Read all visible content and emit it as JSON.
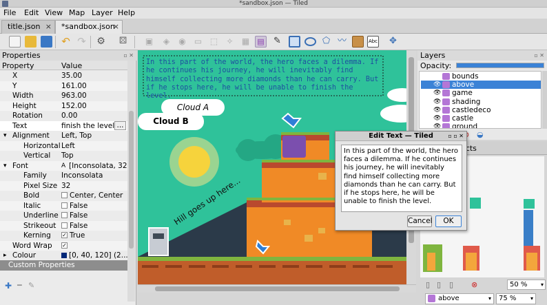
{
  "window": {
    "title": "*sandbox.json — Tiled"
  },
  "menu": [
    "File",
    "Edit",
    "View",
    "Map",
    "Layer",
    "Help"
  ],
  "tabs": [
    {
      "label": "title.json",
      "close": "×"
    },
    {
      "label": "*sandbox.json",
      "close": "×"
    }
  ],
  "properties": {
    "title": "Properties",
    "col_property": "Property",
    "col_value": "Value",
    "rows": [
      {
        "key": "X",
        "value": "35.00"
      },
      {
        "key": "Y",
        "value": "161.00"
      },
      {
        "key": "Width",
        "value": "963.00"
      },
      {
        "key": "Height",
        "value": "152.00"
      },
      {
        "key": "Rotation",
        "value": "0.00"
      },
      {
        "key": "Text",
        "value": "finish the level.",
        "button": "..."
      },
      {
        "key": "Alignment",
        "value": "Left, Top",
        "expander": "▾"
      },
      {
        "key": "Horizontal",
        "value": "Left"
      },
      {
        "key": "Vertical",
        "value": "Top"
      },
      {
        "key": "Font",
        "value": "[Inconsolata, 32]",
        "expander": "▾",
        "value_icon": "A"
      },
      {
        "key": "Family",
        "value": "Inconsolata"
      },
      {
        "key": "Pixel Size",
        "value": "32"
      },
      {
        "key": "Bold",
        "value": "Center, Center",
        "checked": false
      },
      {
        "key": "Italic",
        "value": "False",
        "checked": false
      },
      {
        "key": "Underline",
        "value": "False",
        "checked": false
      },
      {
        "key": "Strikeout",
        "value": "False",
        "checked": false
      },
      {
        "key": "Kerning",
        "value": "True",
        "checked": true
      },
      {
        "key": "Word Wrap",
        "value": "",
        "checked": true
      },
      {
        "key": "Colour",
        "value": "[0, 40, 120] (2...",
        "expander": "▸",
        "swatch": "#002878"
      }
    ],
    "custom_properties": "Custom Properties"
  },
  "map": {
    "selected_text": "In this part of the world, the hero faces a dilemma. If he continues his journey, he will inevitably find himself collecting more diamonds than he can carry. But if he stops here, he will be unable to finish the level.",
    "cloud_a": "Cloud A",
    "cloud_b": "Cloud B",
    "hill_text": "Hill goes up here..."
  },
  "layers": {
    "title": "Layers",
    "opacity_label": "Opacity:",
    "items": [
      {
        "name": "bounds",
        "visible": false
      },
      {
        "name": "above",
        "visible": true,
        "selected": true
      },
      {
        "name": "game",
        "visible": true
      },
      {
        "name": "shading",
        "visible": true
      },
      {
        "name": "castledeco",
        "visible": true
      },
      {
        "name": "castle",
        "visible": true
      },
      {
        "name": "ground",
        "visible": true
      }
    ]
  },
  "tilesets": {
    "tab_label": "jects"
  },
  "zoom": {
    "tileset_zoom": "50 %",
    "map_zoom": "75 %",
    "layer_select": "above"
  },
  "dialog": {
    "title": "Edit Text — Tiled",
    "text": "In this part of the world, the hero faces a dilemma. If he continues his journey, he will inevitably find himself collecting more diamonds than he can carry. But if he stops here, he will be unable to finish the level.",
    "cancel": "Cancel",
    "ok": "OK"
  },
  "colors": {
    "accent": "#3b82d6",
    "map_bg": "#2fc29a",
    "text_blue": "#002878"
  }
}
